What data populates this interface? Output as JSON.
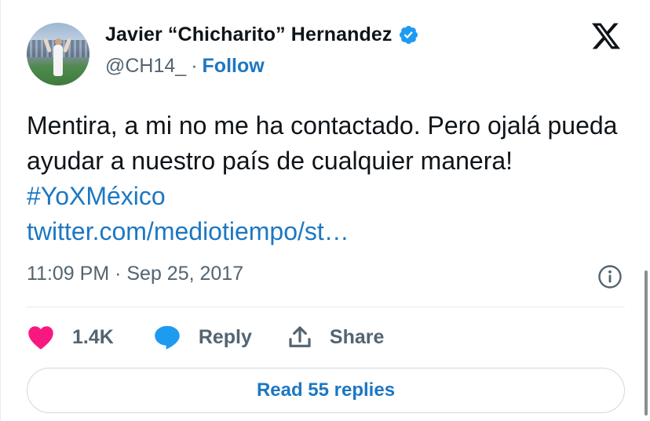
{
  "author": {
    "name": "Javier “Chicharito” Hernandez",
    "handle": "@CH14_",
    "separator": "·",
    "follow_label": "Follow",
    "verified": true
  },
  "tweet": {
    "text": "Mentira, a mi no me ha contactado. Pero ojalá pueda ayudar a nuestro país de cualquier manera!",
    "hashtag": "#YoXMéxico",
    "link": "twitter.com/mediotiempo/st…",
    "timestamp": "11:09 PM · Sep 25, 2017"
  },
  "actions": {
    "like_count": "1.4K",
    "reply_label": "Reply",
    "share_label": "Share"
  },
  "replies_button": "Read 55 replies",
  "colors": {
    "accent": "#1d77c2",
    "like": "#f91880",
    "verified": "#1d9bf0",
    "muted": "#536471"
  },
  "icons": [
    "verified-badge-icon",
    "x-logo-icon",
    "info-icon",
    "heart-icon",
    "reply-bubble-icon",
    "share-icon"
  ]
}
